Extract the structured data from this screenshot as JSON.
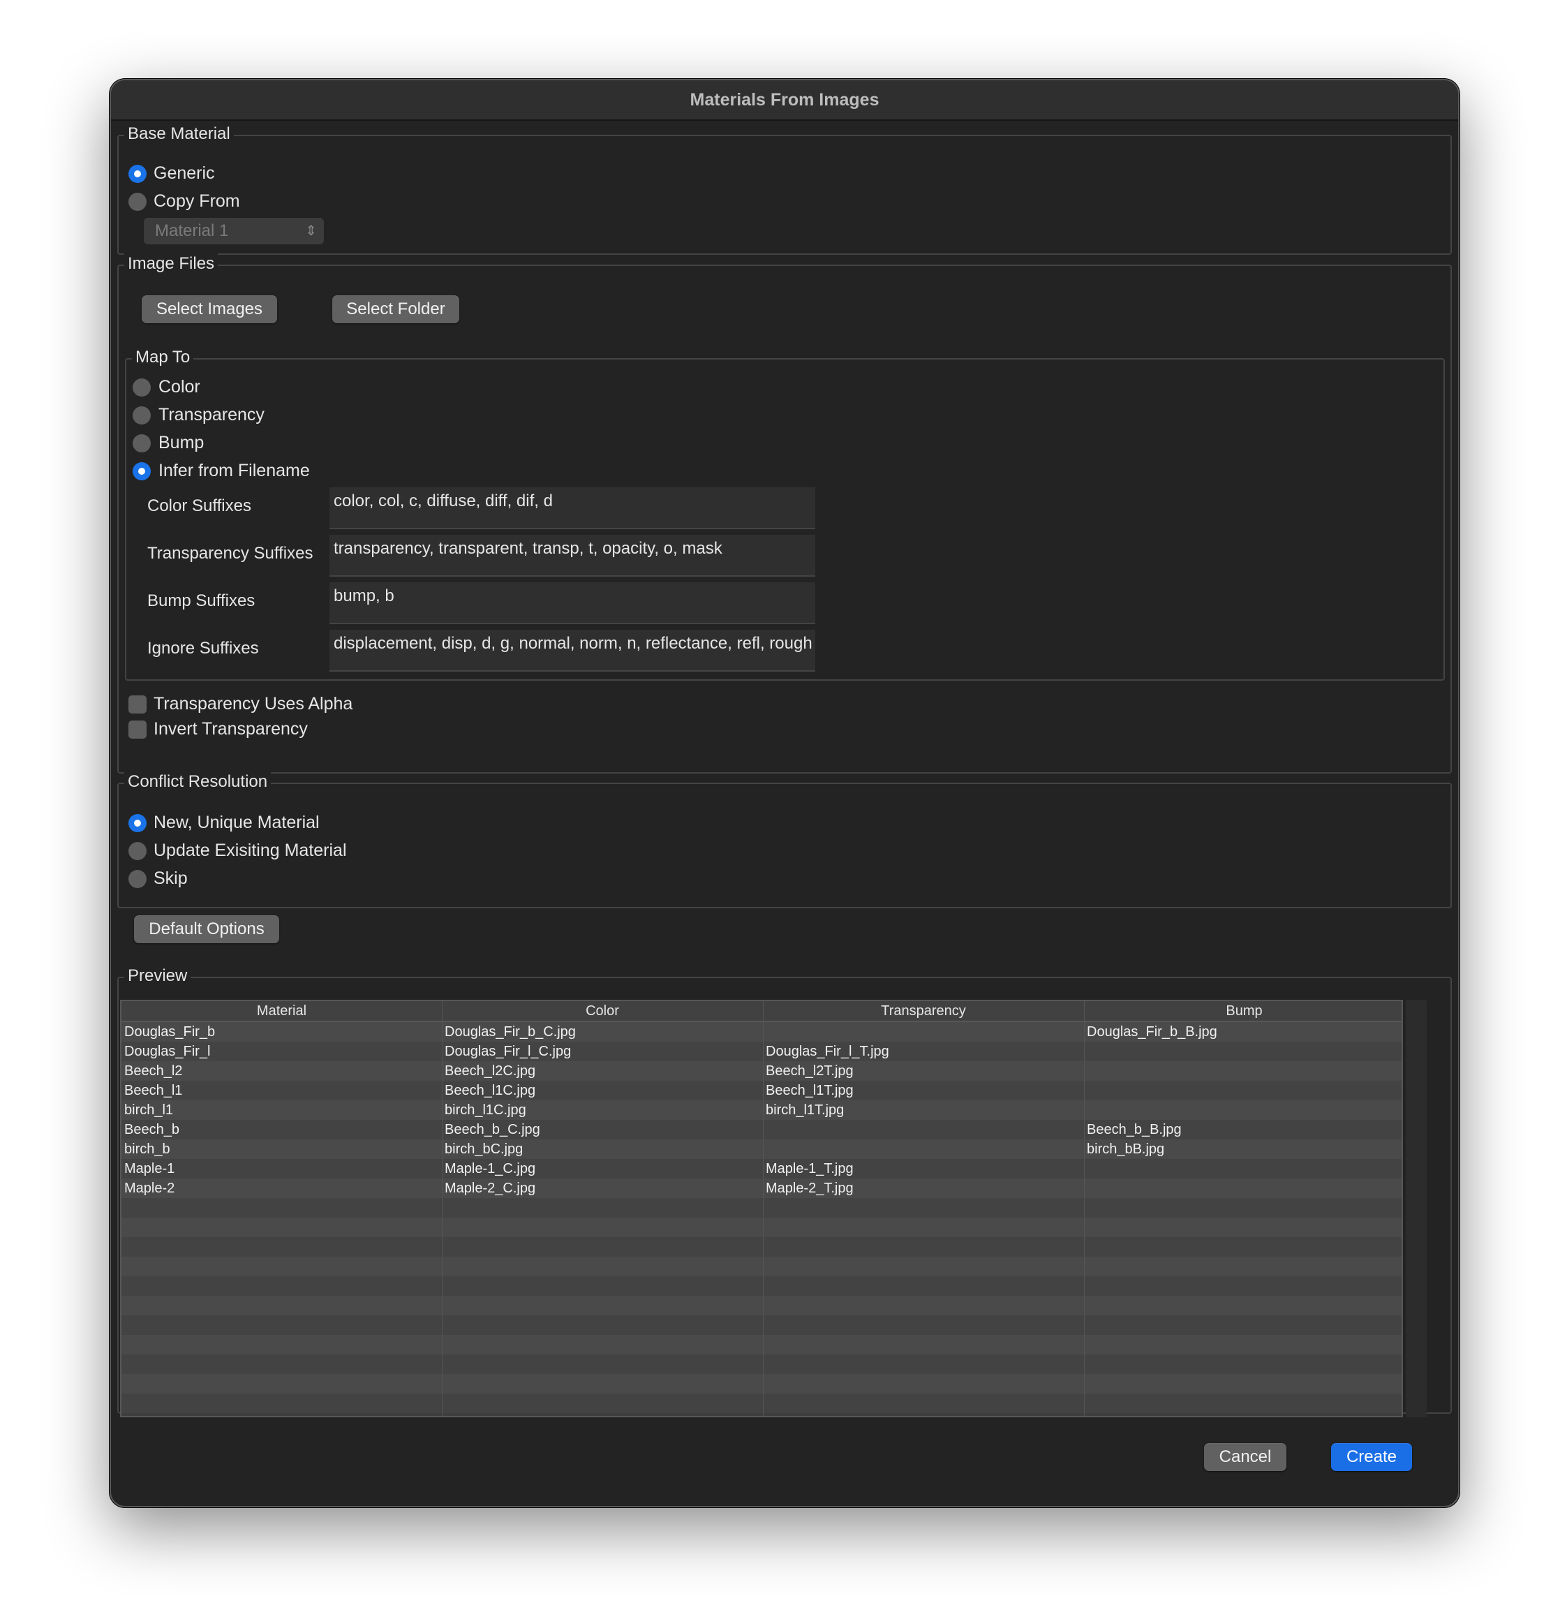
{
  "window": {
    "title": "Materials From Images"
  },
  "base_material": {
    "legend": "Base Material",
    "options": [
      {
        "label": "Generic",
        "selected": true
      },
      {
        "label": "Copy From",
        "selected": false
      }
    ],
    "copy_from_value": "Material 1"
  },
  "image_files": {
    "legend": "Image Files",
    "select_images": "Select Images",
    "select_folder": "Select Folder",
    "map_to": {
      "legend": "Map To",
      "options": [
        {
          "label": "Color",
          "selected": false
        },
        {
          "label": "Transparency",
          "selected": false
        },
        {
          "label": "Bump",
          "selected": false
        },
        {
          "label": "Infer from Filename",
          "selected": true
        }
      ],
      "suffixes": [
        {
          "label": "Color Suffixes",
          "value": "color, col, c, diffuse, diff, dif, d"
        },
        {
          "label": "Transparency Suffixes",
          "value": "transparency, transparent, transp, t, opacity, o, mask"
        },
        {
          "label": "Bump Suffixes",
          "value": "bump, b"
        },
        {
          "label": "Ignore Suffixes",
          "value": "displacement, disp, d, g, normal, norm, n, reflectance, refl, rough"
        }
      ]
    },
    "checkboxes": [
      {
        "label": "Transparency Uses Alpha",
        "checked": false
      },
      {
        "label": "Invert Transparency",
        "checked": false
      }
    ]
  },
  "conflict": {
    "legend": "Conflict Resolution",
    "options": [
      {
        "label": "New, Unique Material",
        "selected": true
      },
      {
        "label": "Update Exisiting Material",
        "selected": false
      },
      {
        "label": "Skip",
        "selected": false
      }
    ]
  },
  "default_options": "Default Options",
  "preview": {
    "legend": "Preview",
    "columns": [
      "Material",
      "Color",
      "Transparency",
      "Bump"
    ],
    "rows": [
      [
        "Douglas_Fir_b",
        "Douglas_Fir_b_C.jpg",
        "",
        "Douglas_Fir_b_B.jpg"
      ],
      [
        "Douglas_Fir_l",
        "Douglas_Fir_l_C.jpg",
        "Douglas_Fir_l_T.jpg",
        ""
      ],
      [
        "Beech_l2",
        "Beech_l2C.jpg",
        "Beech_l2T.jpg",
        ""
      ],
      [
        "Beech_l1",
        "Beech_l1C.jpg",
        "Beech_l1T.jpg",
        ""
      ],
      [
        "birch_l1",
        "birch_l1C.jpg",
        "birch_l1T.jpg",
        ""
      ],
      [
        "Beech_b",
        "Beech_b_C.jpg",
        "",
        "Beech_b_B.jpg"
      ],
      [
        "birch_b",
        "birch_bC.jpg",
        "",
        "birch_bB.jpg"
      ],
      [
        "Maple-1",
        "Maple-1_C.jpg",
        "Maple-1_T.jpg",
        ""
      ],
      [
        "Maple-2",
        "Maple-2_C.jpg",
        "Maple-2_T.jpg",
        ""
      ]
    ]
  },
  "footer": {
    "cancel": "Cancel",
    "create": "Create"
  },
  "colors": {
    "accent": "#1a73e8",
    "window_bg": "#232323"
  }
}
